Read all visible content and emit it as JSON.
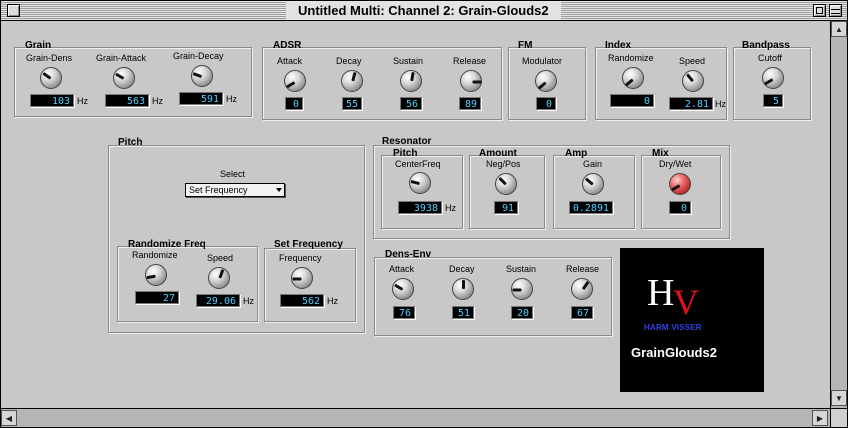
{
  "window": {
    "title": "Untitled Multi: Channel 2: Grain-Glouds2"
  },
  "grain": {
    "title": "Grain",
    "dens_label": "Grain-Dens",
    "dens_value": "103",
    "dens_unit": "Hz",
    "attack_label": "Grain-Attack",
    "attack_value": "563",
    "attack_unit": "Hz",
    "decay_label": "Grain-Decay",
    "decay_value": "591",
    "decay_unit": "Hz"
  },
  "adsr": {
    "title": "ADSR",
    "attack_label": "Attack",
    "attack_value": "0",
    "decay_label": "Decay",
    "decay_value": "55",
    "sustain_label": "Sustain",
    "sustain_value": "56",
    "release_label": "Release",
    "release_value": "89"
  },
  "fm": {
    "title": "FM",
    "modulator_label": "Modulator",
    "modulator_value": "0"
  },
  "index": {
    "title": "Index",
    "randomize_label": "Randomize",
    "randomize_value": "0",
    "speed_label": "Speed",
    "speed_value": "2.81",
    "speed_unit": "Hz"
  },
  "bandpass": {
    "title": "Bandpass",
    "cutoff_label": "Cutoff",
    "cutoff_value": "5"
  },
  "pitch": {
    "title": "Pitch",
    "select_label": "Select",
    "select_value": "Set Frequency",
    "randomize_freq": {
      "title": "Randomize Freq",
      "randomize_label": "Randomize",
      "randomize_value": "27",
      "speed_label": "Speed",
      "speed_value": "29.06",
      "speed_unit": "Hz"
    },
    "set_frequency": {
      "title": "Set Frequency",
      "frequency_label": "Frequency",
      "frequency_value": "562",
      "frequency_unit": "Hz"
    }
  },
  "resonator": {
    "title": "Resonator",
    "pitch_title": "Pitch",
    "centerfreq_label": "CenterFreq",
    "centerfreq_value": "3938",
    "centerfreq_unit": "Hz",
    "amount_title": "Amount",
    "negpos_label": "Neg/Pos",
    "negpos_value": "91",
    "amp_title": "Amp",
    "gain_label": "Gain",
    "gain_value": "0.2891",
    "mix_title": "Mix",
    "drywet_label": "Dry/Wet",
    "drywet_value": "0"
  },
  "densenv": {
    "title": "Dens-Env",
    "attack_label": "Attack",
    "attack_value": "76",
    "decay_label": "Decay",
    "decay_value": "51",
    "sustain_label": "Sustain",
    "sustain_value": "20",
    "release_label": "Release",
    "release_value": "67"
  },
  "logo": {
    "initial_h": "H",
    "initial_v": "V",
    "author": "HARM VISSER",
    "product": "GrainGlouds2"
  },
  "colors": {
    "display_text": "#4fd0ff",
    "display_bg": "#000000",
    "logo_v": "#e0101c",
    "logo_author": "#3040e8",
    "mix_knob": "#e05050"
  }
}
